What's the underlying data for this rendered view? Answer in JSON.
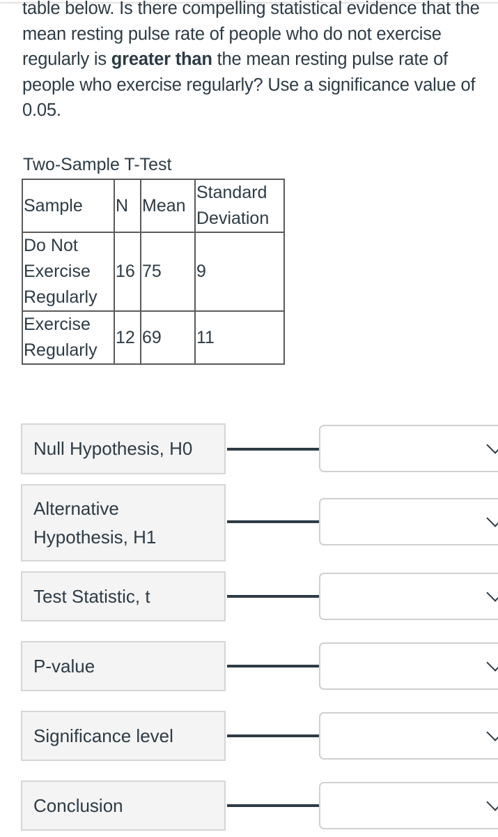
{
  "question": {
    "text_before_bold": "table below. Is there compelling statistical evidence that the mean resting pulse rate of people who do not exercise regularly is ",
    "bold_text": "greater than",
    "text_after_bold": " the mean resting pulse rate of people who exercise regularly? Use a significance value of 0.05."
  },
  "table": {
    "title": "Two-Sample T-Test",
    "headers": [
      "Sample",
      "N",
      "Mean",
      "Standard Deviation"
    ],
    "rows": [
      {
        "sample": "Do Not Exercise Regularly",
        "n": "16",
        "mean": "75",
        "sd": "9"
      },
      {
        "sample": "Exercise Regularly",
        "n": "12",
        "mean": "69",
        "sd": "11"
      }
    ]
  },
  "matching": {
    "items": [
      {
        "label": "Null Hypothesis, H0",
        "selected": ""
      },
      {
        "label": "Alternative Hypothesis, H1",
        "selected": ""
      },
      {
        "label": "Test Statistic, t",
        "selected": ""
      },
      {
        "label": "P-value",
        "selected": ""
      },
      {
        "label": "Significance level",
        "selected": ""
      },
      {
        "label": "Conclusion",
        "selected": ""
      }
    ],
    "dropdown_icon": "chevron-down-icon"
  }
}
